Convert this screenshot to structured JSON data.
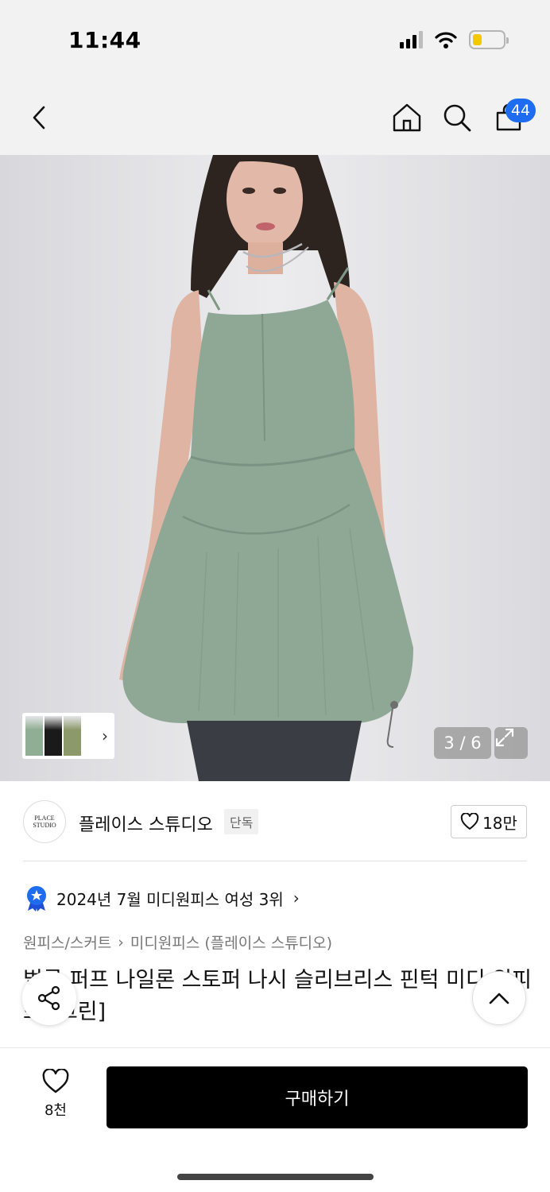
{
  "status_bar": {
    "time": "11:44",
    "signal_bars": 4,
    "signal_bars_active": 3,
    "battery_level": 0.3,
    "battery_color": "#f5c800",
    "icons": [
      "signal-icon",
      "wifi-icon",
      "battery-icon"
    ]
  },
  "navbar": {
    "icons": [
      "back-icon",
      "home-icon",
      "search-icon",
      "cart-icon"
    ],
    "cart_count": "44",
    "badge_color": "#1e6cf0"
  },
  "gallery": {
    "counter": "3 / 6",
    "thumb_colors": [
      "#8fae93",
      "#1a1a1a",
      "#8c9a6b"
    ],
    "arrow": "›",
    "dress_color": "#8fa896"
  },
  "brand": {
    "logo_text": "PLACE STUDIO",
    "name": "플레이스 스튜디오",
    "badge": "단독",
    "likes": "18만"
  },
  "ranking": {
    "text": "2024년 7월 미디원피스 여성 3위",
    "chevron": "›"
  },
  "breadcrumb": {
    "category": "원피스/스커트",
    "separator": "›",
    "subcategory": "미디원피스 (플레이스 스튜디오)"
  },
  "product": {
    "title": "벌룬 퍼프 나일론 스토퍼 나시 슬리브리스 핀턱 미디 원피스 [그린]"
  },
  "bottom": {
    "wish_count": "8천",
    "buy_label": "구매하기"
  }
}
